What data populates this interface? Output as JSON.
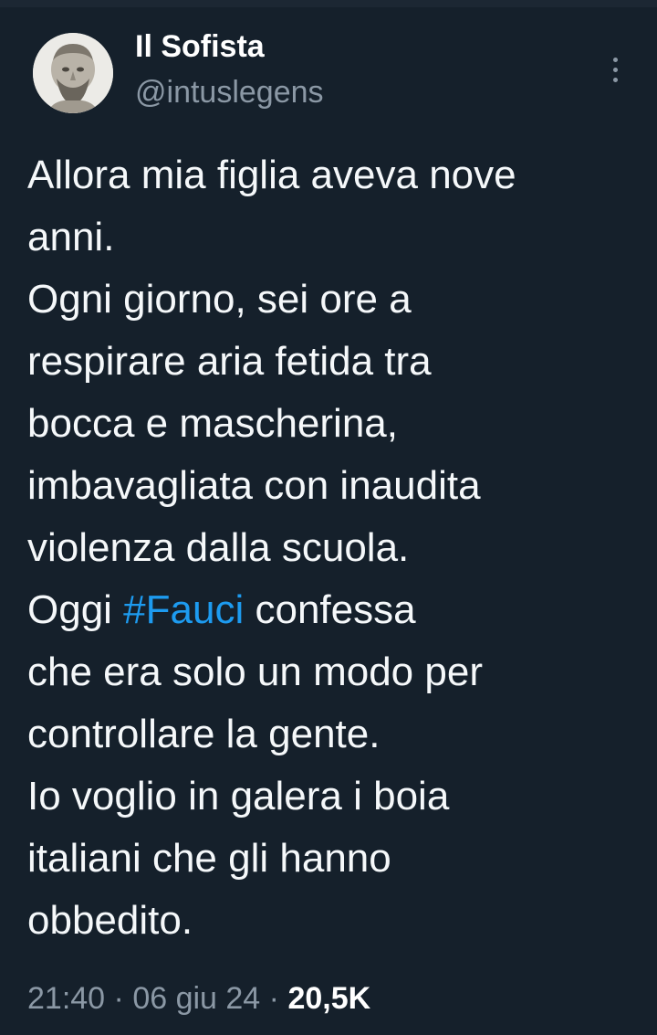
{
  "author": {
    "display_name": "Il Sofista",
    "handle": "@intuslegens",
    "avatar_icon": "philosopher-bust-avatar"
  },
  "tweet": {
    "lines": [
      {
        "text": "Allora mia figlia aveva nove"
      },
      {
        "text": "anni."
      },
      {
        "text": "Ogni giorno, sei ore a"
      },
      {
        "text": "respirare aria fetida tra"
      },
      {
        "text": "bocca e mascherina,"
      },
      {
        "text": "imbavagliata con inaudita"
      },
      {
        "text": "violenza dalla scuola."
      },
      {
        "before": "Oggi ",
        "hashtag": "#Fauci",
        "after": " confessa"
      },
      {
        "text": "che era solo un modo per"
      },
      {
        "text": "controllare la gente."
      },
      {
        "text": "Io voglio in galera i boia"
      },
      {
        "text": "italiani che gli hanno"
      },
      {
        "text": "obbedito."
      }
    ]
  },
  "meta": {
    "time": "21:40",
    "separator": " · ",
    "date": "06 giu 24",
    "views": "20,5K"
  },
  "colors": {
    "background": "#15202b",
    "hashtag": "#1d9bf0",
    "secondary_text": "#8b98a5"
  }
}
